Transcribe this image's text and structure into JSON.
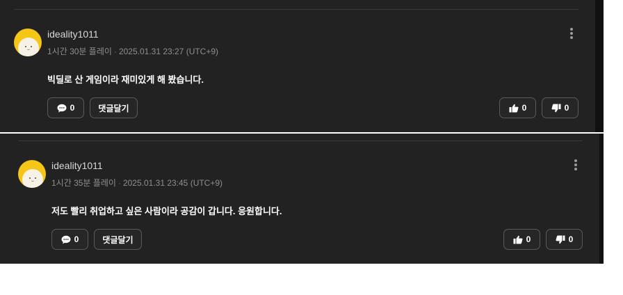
{
  "comments": [
    {
      "username": "ideality1011",
      "playtime": "1시간 30분 플레이",
      "separator": "·",
      "timestamp": "2025.01.31 23:27 (UTC+9)",
      "text": "빅딜로 산 게임이라 재미있게 해 봤습니다.",
      "reply_count": "0",
      "reply_button_label": "댓글달기",
      "like_count": "0",
      "dislike_count": "0"
    },
    {
      "username": "ideality1011",
      "playtime": "1시간 35분 플레이",
      "separator": "·",
      "timestamp": "2025.01.31 23:45 (UTC+9)",
      "text": "저도 빨리 취업하고 싶은 사람이라 공감이 갑니다. 응원합니다.",
      "reply_count": "0",
      "reply_button_label": "댓글달기",
      "like_count": "0",
      "dislike_count": "0"
    }
  ],
  "colors": {
    "panel_bg": "#222222",
    "avatar_bg": "#f5c518",
    "text_primary": "#ffffff",
    "text_secondary": "#8f8f8f"
  },
  "icons": [
    "chat-bubble-icon",
    "thumbs-up-icon",
    "thumbs-down-icon",
    "more-vertical-icon",
    "avatar"
  ]
}
